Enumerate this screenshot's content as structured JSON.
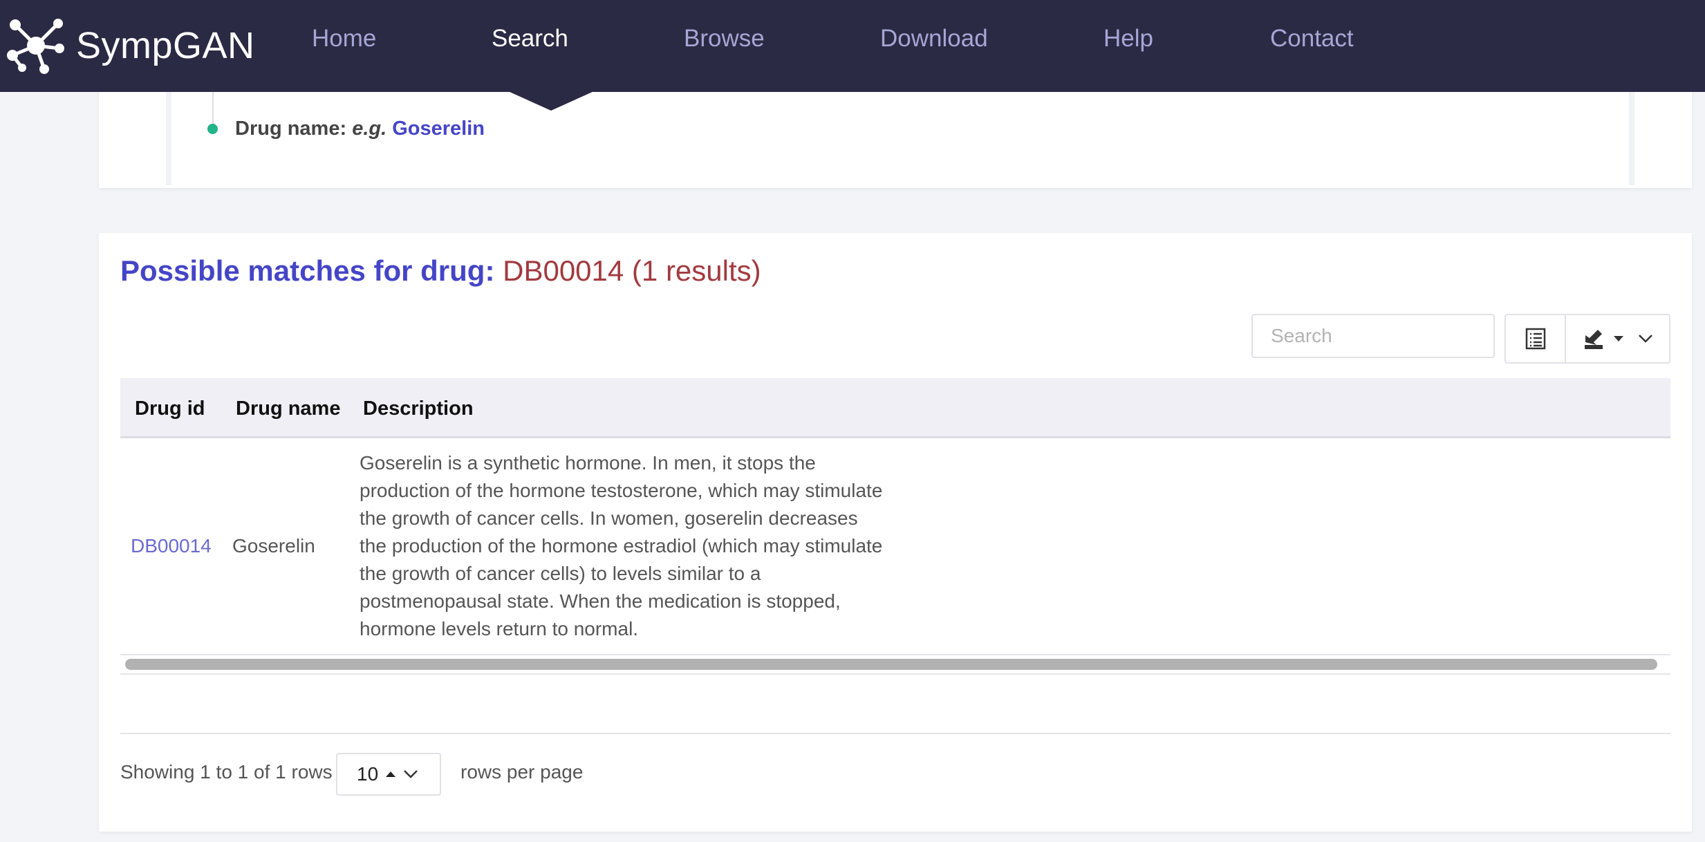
{
  "nav": {
    "brand": "SympGAN",
    "items": [
      "Home",
      "Search",
      "Browse",
      "Download",
      "Help",
      "Contact"
    ],
    "active": "Search"
  },
  "example": {
    "label": "Drug name:",
    "eg": "e.g.",
    "value": "Goserelin"
  },
  "results": {
    "title_prefix": "Possible matches for drug:",
    "query": "DB00014 (1 results)"
  },
  "toolbar": {
    "search_placeholder": "Search",
    "columns_icon": "list-icon",
    "export_icon": "download-icon"
  },
  "table": {
    "headers": [
      "Drug id",
      "Drug name",
      "Description"
    ],
    "rows": [
      {
        "drug_id": "DB00014",
        "drug_name": "Goserelin",
        "description": "Goserelin is a synthetic hormone. In men, it stops the production of the hormone testosterone, which may stimulate the growth of cancer cells. In women, goserelin decreases the production of the hormone estradiol (which may stimulate the growth of cancer cells) to levels similar to a postmenopausal state. When the medication is stopped, hormone levels return to normal."
      }
    ]
  },
  "pagination": {
    "showing": "Showing 1 to 1 of 1 rows",
    "page_size": "10",
    "suffix": "rows per page"
  },
  "colors": {
    "navbar": "#2b2a44",
    "accent": "#4545c7",
    "query": "#a23a3f",
    "dot": "#22b38a"
  }
}
